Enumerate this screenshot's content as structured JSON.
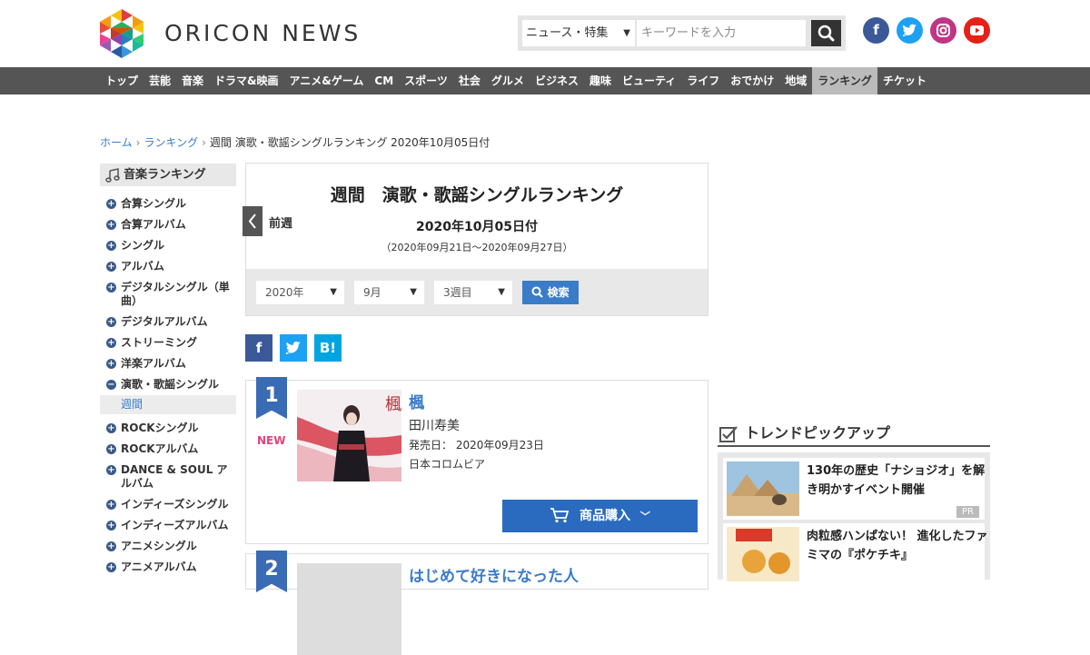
{
  "header": {
    "logo_text": "ORICON NEWS",
    "search": {
      "category": "ニュース・特集",
      "placeholder": "キーワードを入力"
    },
    "sns": [
      "facebook-icon",
      "twitter-icon",
      "instagram-icon",
      "youtube-icon"
    ]
  },
  "nav": {
    "items": [
      "トップ",
      "芸能",
      "音楽",
      "ドラマ&映画",
      "アニメ&ゲーム",
      "CM",
      "スポーツ",
      "社会",
      "グルメ",
      "ビジネス",
      "趣味",
      "ビューティ",
      "ライフ",
      "おでかけ",
      "地域",
      "ランキング",
      "チケット"
    ],
    "active": "ランキング"
  },
  "breadcrumb": {
    "home": "ホーム",
    "ranking": "ランキング",
    "current": "週間 演歌・歌謡シングルランキング 2020年10月05日付"
  },
  "sidebar": {
    "title": "音楽ランキング",
    "items": [
      "合算シングル",
      "合算アルバム",
      "シングル",
      "アルバム",
      "デジタルシングル（単曲）",
      "デジタルアルバム",
      "ストリーミング",
      "洋楽アルバム",
      "演歌・歌謡シングル",
      "週間",
      "ROCKシングル",
      "ROCKアルバム",
      "DANCE & SOUL アルバム",
      "インディーズシングル",
      "インディーズアルバム",
      "アニメシングル",
      "アニメアルバム"
    ]
  },
  "ranking": {
    "title": "週間　演歌・歌謡シングルランキング",
    "prev_label": "前週",
    "date": "2020年10月05日付",
    "range": "（2020年09月21日～2020年09月27日）",
    "filters": {
      "year": "2020年",
      "month": "9月",
      "week": "3週目",
      "search_label": "検索"
    }
  },
  "share": {
    "facebook": "f",
    "hatena": "B!"
  },
  "entries": [
    {
      "rank": "1",
      "badge": "NEW",
      "title": "楓",
      "artist": "田川寿美",
      "release": "発売日：  2020年09月23日",
      "label": "日本コロムビア",
      "buy": "商品購入"
    },
    {
      "rank": "2",
      "title": "はじめて好きになった人"
    }
  ],
  "trend": {
    "title": "トレンドピックアップ",
    "items": [
      {
        "text": "130年の歴史「ナショジオ」を解き明かすイベント開催",
        "badge": "PR"
      },
      {
        "text": "肉粒感ハンぱない！ 進化したファミマの『ポケチキ』"
      }
    ]
  },
  "colors": {
    "nav_bg": "#555555",
    "accent_blue": "#3a7cc8",
    "rank_badge": "#3a6bb5",
    "new_badge": "#e0457b",
    "buy_button": "#2a6bc0"
  }
}
